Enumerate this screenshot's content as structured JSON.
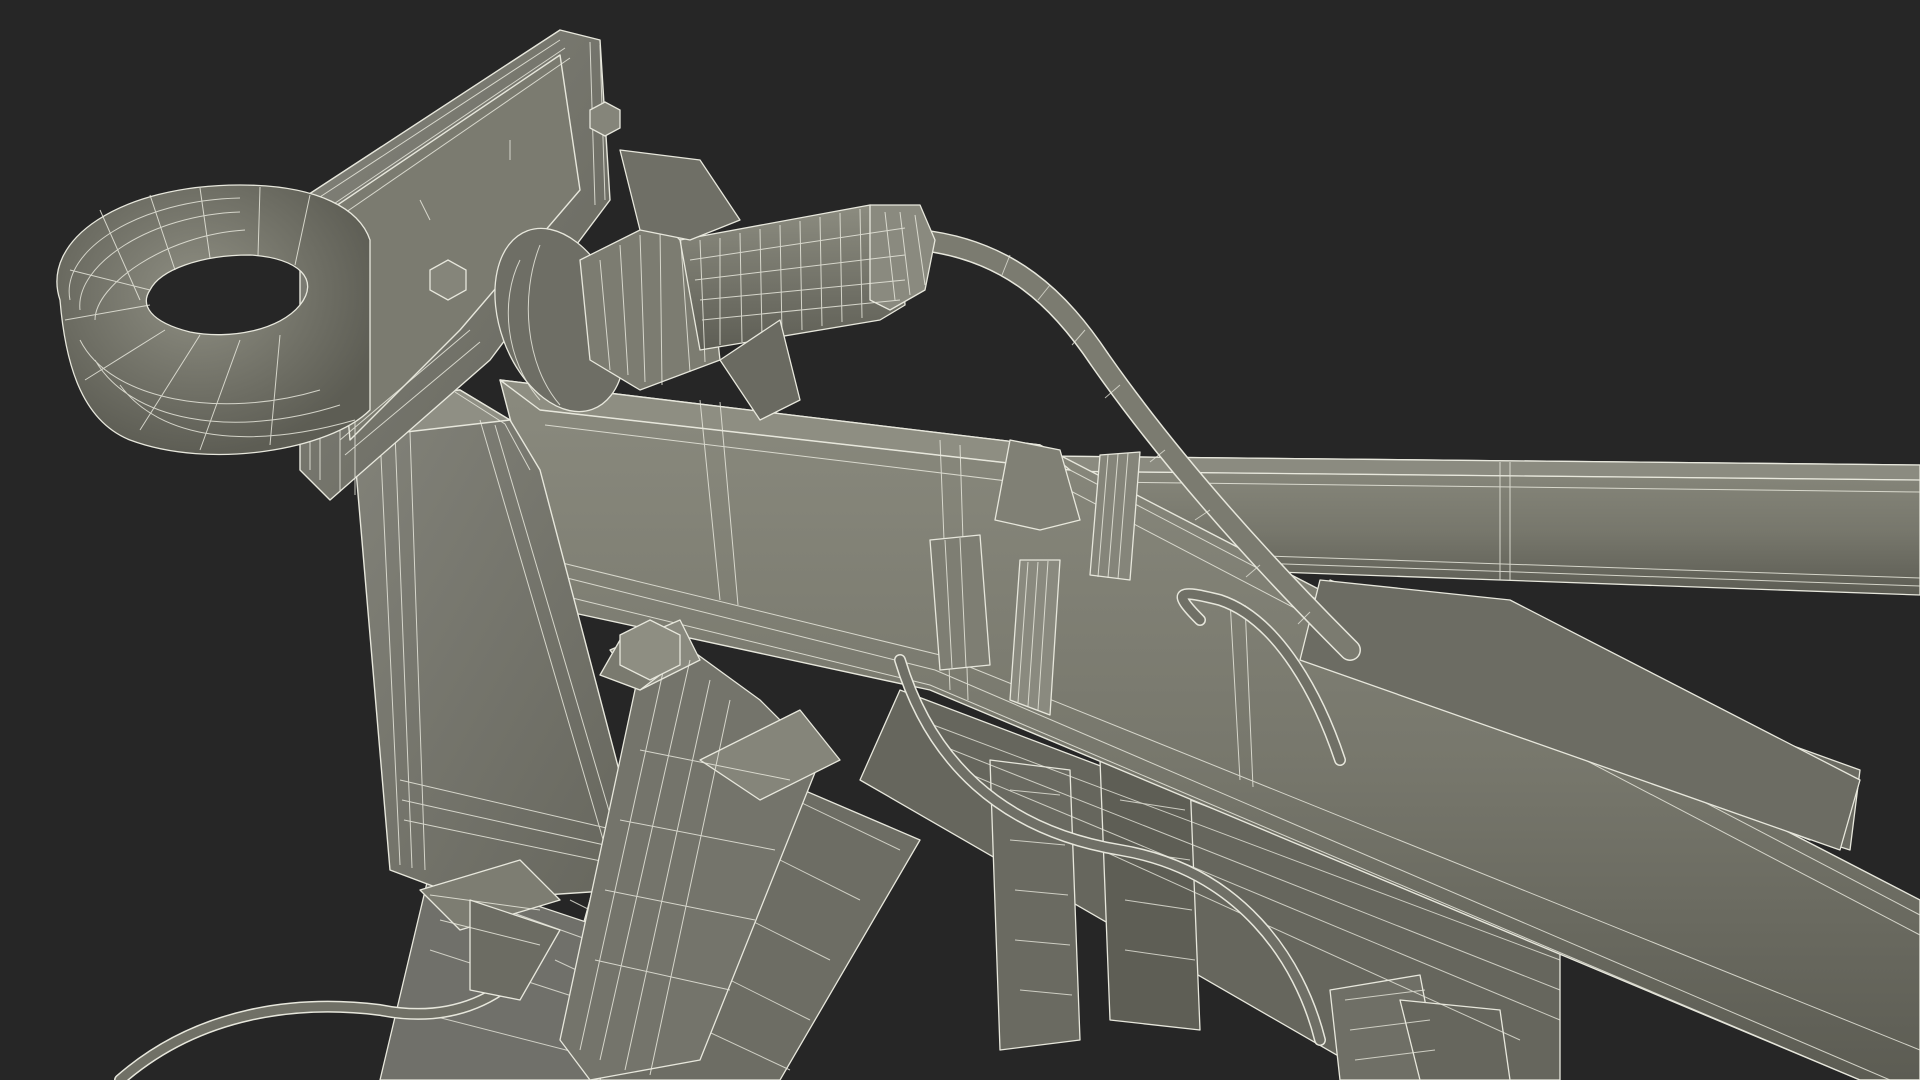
{
  "scene": {
    "background_color": "#262626",
    "surface_color": "#77776c",
    "surface_dark_color": "#5f5f56",
    "surface_light_color": "#8a8a7e",
    "wire_color": "#e7e7dc"
  }
}
